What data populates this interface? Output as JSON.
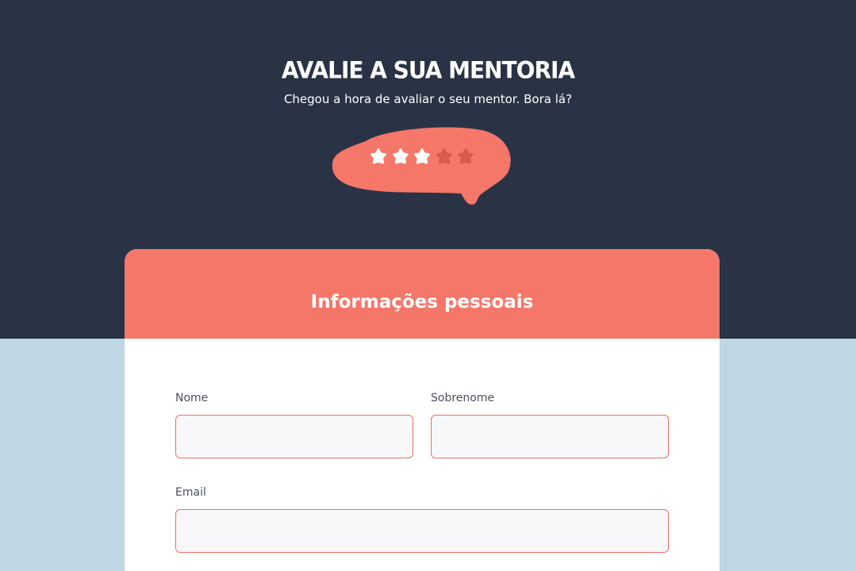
{
  "header": {
    "title": "AVALIE A SUA MENTORIA",
    "subtitle": "Chegou a hora de avaliar o seu mentor. Bora lá?"
  },
  "rating": {
    "value": 3,
    "max": 5,
    "filled_color": "#ffffff",
    "empty_color": "#d95a4f",
    "bubble_color": "#f5776a",
    "icon": "star-icon"
  },
  "form": {
    "section_title": "Informações pessoais",
    "fields": {
      "first_name": {
        "label": "Nome",
        "value": "",
        "placeholder": ""
      },
      "last_name": {
        "label": "Sobrenome",
        "value": "",
        "placeholder": ""
      },
      "email": {
        "label": "Email",
        "value": "",
        "placeholder": ""
      }
    }
  },
  "colors": {
    "hero_bg": "#293345",
    "page_bg": "#bfd6e3",
    "accent": "#f5776a",
    "input_border": "#ee6e63"
  }
}
